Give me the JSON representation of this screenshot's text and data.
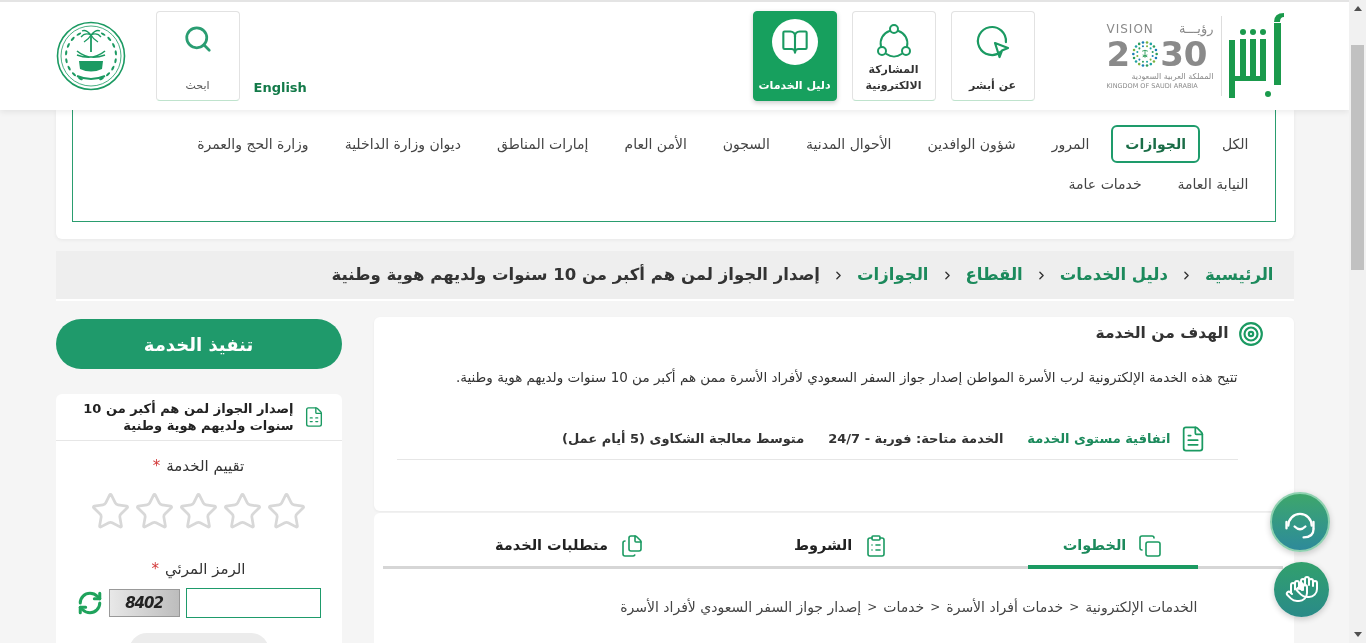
{
  "header": {
    "nav": [
      {
        "label": "عن أبشر",
        "selected": false
      },
      {
        "label": "المشاركة الالكترونية",
        "selected": false
      },
      {
        "label": "دليل الخدمات",
        "selected": true
      }
    ],
    "vision_logo": {
      "title_en": "VISION",
      "title_ar": "رؤيـــة",
      "number_start": "2",
      "number_end": "30",
      "country_ar": "المملكة العربية السعودية",
      "country_en": "KINGDOM OF SAUDI ARABIA"
    },
    "language_link": "English",
    "search_label": "ابحث"
  },
  "categories": [
    {
      "label": "الكل",
      "selected": false
    },
    {
      "label": "الجوازات",
      "selected": true
    },
    {
      "label": "المرور",
      "selected": false
    },
    {
      "label": "شؤون الوافدين",
      "selected": false
    },
    {
      "label": "الأحوال المدنية",
      "selected": false
    },
    {
      "label": "السجون",
      "selected": false
    },
    {
      "label": "الأمن العام",
      "selected": false
    },
    {
      "label": "إمارات المناطق",
      "selected": false
    },
    {
      "label": "ديوان وزارة الداخلية",
      "selected": false
    },
    {
      "label": "وزارة الحج والعمرة",
      "selected": false
    },
    {
      "label": "النيابة العامة",
      "selected": false
    },
    {
      "label": "خدمات عامة",
      "selected": false
    }
  ],
  "breadcrumb": [
    {
      "label": "الرئيسية",
      "kind": "link"
    },
    {
      "label": "دليل الخدمات",
      "kind": "link"
    },
    {
      "label": "القطاع",
      "kind": "link"
    },
    {
      "label": "الجوازات",
      "kind": "link"
    },
    {
      "label": "إصدار الجواز لمن هم أكبر من 10 سنوات ولديهم هوية وطنية",
      "kind": "current"
    }
  ],
  "goal": {
    "title": "الهدف من الخدمة",
    "description": "تتيح هذه الخدمة الإلكترونية لرب الأسرة المواطن إصدار جواز السفر السعودي لأفراد الأسرة ممن هم أكبر من 10 سنوات ولديهم هوية وطنية."
  },
  "sla": {
    "title": "اتفاقية مستوى الخدمة",
    "items": [
      "الخدمة متاحة: فورية - 24/7",
      "متوسط معالجة الشكاوى (5 أيام عمل)"
    ]
  },
  "tabs": [
    {
      "label": "الخطوات",
      "selected": true
    },
    {
      "label": "الشروط",
      "selected": false
    },
    {
      "label": "متطلبات الخدمة",
      "selected": false
    }
  ],
  "steps_path": {
    "segments": [
      "الخدمات الإلكترونية",
      "خدمات أفراد الأسرة",
      "خدمات",
      "إصدار جواز السفر السعودي لأفراد الأسرة"
    ],
    "separator": ">"
  },
  "sidebar": {
    "execute_button": "تنفيذ الخدمة",
    "service_title": "إصدار الجواز لمن هم أكبر من 10 سنوات ولديهم هوية وطنية",
    "rating": {
      "label": "تقييم الخدمة",
      "required_mark": "*",
      "stars": 0
    },
    "captcha": {
      "label": "الرمز المرئي",
      "required_mark": "*",
      "code": "8402"
    }
  }
}
